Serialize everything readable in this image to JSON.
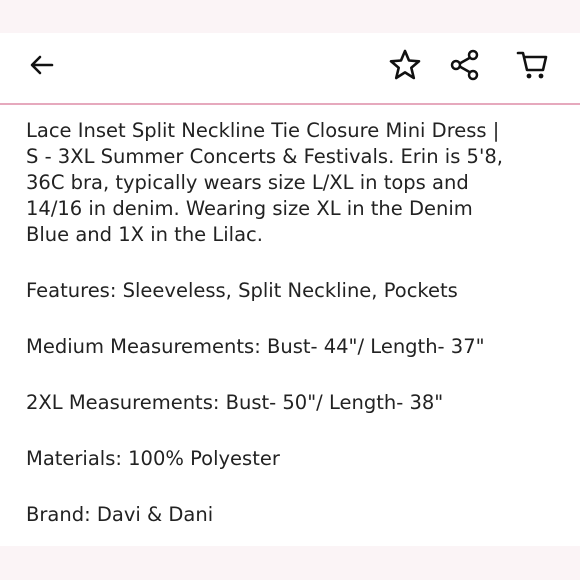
{
  "topbar": {
    "icons": {
      "back": "arrow-left-icon",
      "favorite": "star-icon",
      "share": "share-icon",
      "cart": "cart-icon"
    },
    "divider_color": "#e6a9bd"
  },
  "description": {
    "paragraphs": [
      "Lace Inset Split Neckline Tie Closure Mini Dress |\nS - 3XL Summer Concerts & Festivals. Erin is 5'8,\n36C bra, typically wears size L/XL in tops and\n14/16 in denim. Wearing size XL in the Denim\nBlue and 1X in the Lilac.",
      "Features: Sleeveless, Split Neckline, Pockets",
      "Medium Measurements: Bust- 44\"/ Length- 37\"",
      "2XL  Measurements: Bust- 50\"/ Length- 38\"",
      "Materials: 100% Polyester",
      "Brand: Davi & Dani"
    ]
  }
}
